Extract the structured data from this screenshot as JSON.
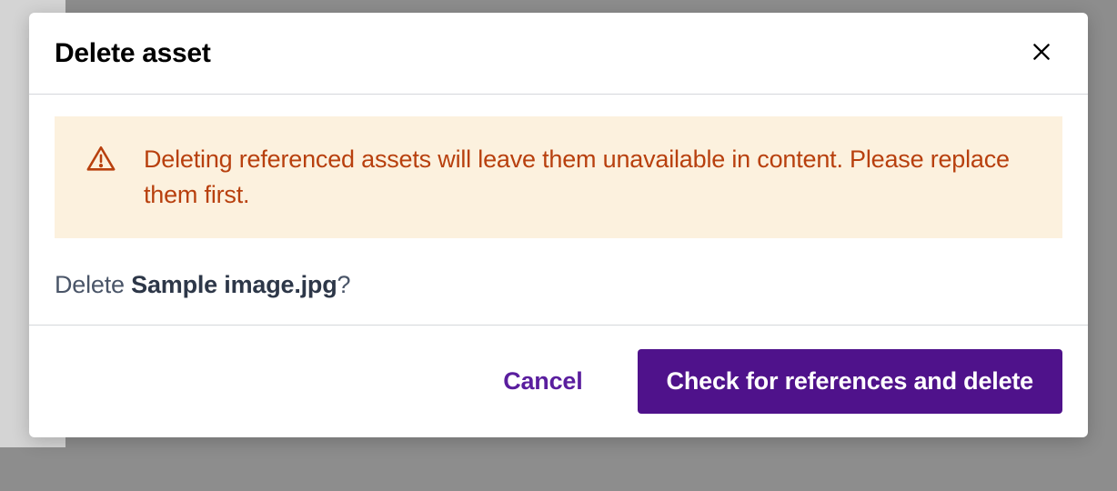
{
  "dialog": {
    "title": "Delete asset",
    "warning": {
      "message": "Deleting referenced assets will leave them unavailable in content. Please replace them first."
    },
    "confirm": {
      "prefix": "Delete ",
      "asset_name": "Sample image.jpg",
      "suffix": "?"
    },
    "actions": {
      "cancel_label": "Cancel",
      "primary_label": "Check for references and delete"
    }
  },
  "colors": {
    "warning_bg": "#fcf1de",
    "warning_text": "#b8400e",
    "primary_button": "#4f128b",
    "link": "#5a1e9e"
  }
}
